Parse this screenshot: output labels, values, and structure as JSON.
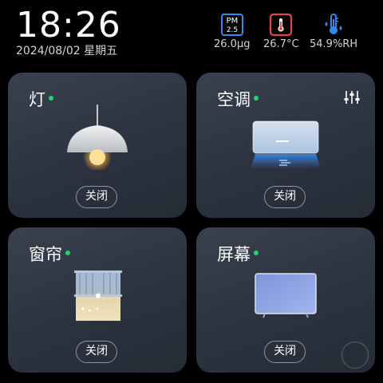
{
  "clock": {
    "time": "18:26",
    "date": "2024/08/02 星期五"
  },
  "sensors": [
    {
      "icon": "pm25-icon",
      "badge_top": "PM",
      "badge_bottom": "2.5",
      "value": "26.0μg"
    },
    {
      "icon": "thermometer-icon",
      "value": "26.7°C"
    },
    {
      "icon": "humidity-icon",
      "value": "54.9%RH"
    }
  ],
  "cards": [
    {
      "title": "灯",
      "status_color": "#1ed66a",
      "button": "关闭",
      "icon": "pendant-lamp-icon"
    },
    {
      "title": "空调",
      "status_color": "#1ed66a",
      "button": "关闭",
      "icon": "air-conditioner-icon",
      "extra_icon": "sliders-icon"
    },
    {
      "title": "窗帘",
      "status_color": "#1ed66a",
      "button": "关闭",
      "icon": "curtain-icon"
    },
    {
      "title": "屏幕",
      "status_color": "#1ed66a",
      "button": "关闭",
      "icon": "tv-screen-icon"
    }
  ],
  "colors": {
    "accent_blue": "#2f8bf0",
    "thermo_red": "#e34848",
    "card_bg": "#323946"
  }
}
